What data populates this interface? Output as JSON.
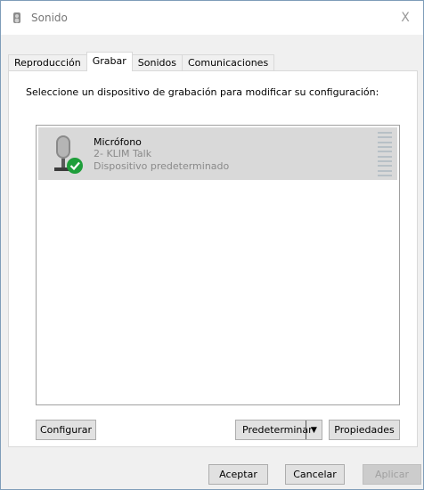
{
  "window": {
    "title": "Sonido",
    "close_glyph": "X"
  },
  "tabs": [
    {
      "label": "Reproducción",
      "active": false
    },
    {
      "label": "Grabar",
      "active": true
    },
    {
      "label": "Sonidos",
      "active": false
    },
    {
      "label": "Comunicaciones",
      "active": false
    }
  ],
  "instruction": "Seleccione un dispositivo de grabación para modificar su configuración:",
  "devices": [
    {
      "name": "Micrófono",
      "detail": "2- KLIM Talk",
      "status": "Dispositivo predeterminado",
      "icon": "microphone-icon",
      "badge_icon": "default-check-icon",
      "selected": true
    }
  ],
  "buttons": {
    "configure": "Configurar",
    "set_default": "Predeterminar",
    "set_default_arrow": "▼",
    "properties": "Propiedades",
    "ok": "Aceptar",
    "cancel": "Cancelar",
    "apply": "Aplicar"
  },
  "colors": {
    "check_badge": "#1e9e3a",
    "selection": "#d9d9d9"
  }
}
